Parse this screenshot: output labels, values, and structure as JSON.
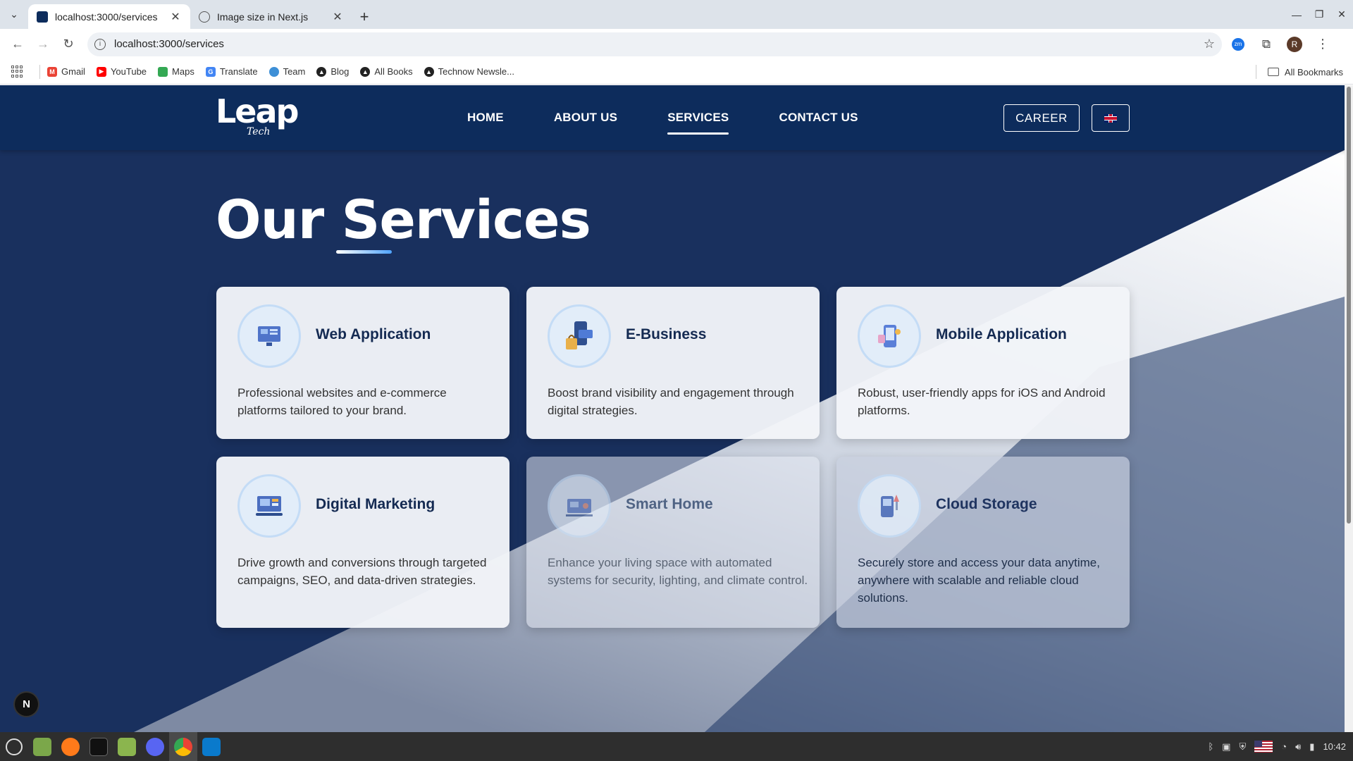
{
  "browser": {
    "tabs": [
      {
        "title": "localhost:3000/services",
        "active": true
      },
      {
        "title": "Image size in Next.js",
        "active": false
      }
    ],
    "url": "localhost:3000/services",
    "bookmarks": [
      "Gmail",
      "YouTube",
      "Maps",
      "Translate",
      "Team",
      "Blog",
      "All Books",
      "Technow Newsle..."
    ],
    "all_bookmarks_label": "All Bookmarks",
    "profile_initial": "R",
    "zoom_ext_label": "zm"
  },
  "site": {
    "logo_main": "Leap",
    "logo_sub": "Tech",
    "nav": [
      "HOME",
      "ABOUT US",
      "SERVICES",
      "CONTACT US"
    ],
    "active_nav": "SERVICES",
    "career_label": "CAREER",
    "language_flag": "uk-flag"
  },
  "hero": {
    "title": "Our Services"
  },
  "services": [
    {
      "title": "Web Application",
      "description": "Professional websites and e-commerce platforms tailored to your brand.",
      "icon": "web-app-icon"
    },
    {
      "title": "E-Business",
      "description": "Boost brand visibility and engagement through digital strategies.",
      "icon": "e-business-icon"
    },
    {
      "title": "Mobile Application",
      "description": "Robust, user-friendly apps for iOS and Android platforms.",
      "icon": "mobile-app-icon"
    },
    {
      "title": "Digital Marketing",
      "description": "Drive growth and conversions through targeted campaigns, SEO, and data-driven strategies.",
      "icon": "digital-marketing-icon"
    },
    {
      "title": "Smart Home",
      "description": "Enhance your living space with automated systems for security, lighting, and climate control.",
      "icon": "smart-home-icon"
    },
    {
      "title": "Cloud Storage",
      "description": "Securely store and access your data anytime, anywhere with scalable and reliable cloud solutions.",
      "icon": "cloud-storage-icon"
    }
  ],
  "dev_badge": "N",
  "taskbar": {
    "clock": "10:42"
  },
  "colors": {
    "nav_bg": "#0d2c5c",
    "page_bg": "#19305e",
    "card_bg": "#f2f4f8",
    "title_text": "#142a52"
  }
}
